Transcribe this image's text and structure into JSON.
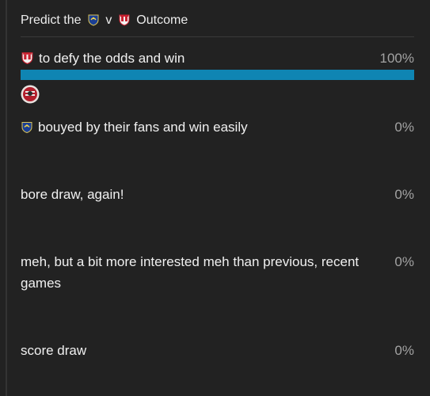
{
  "poll": {
    "title_prefix": "Predict the",
    "title_vs": "v",
    "title_suffix": "Outcome",
    "accent_color": "#0f85b3",
    "home_team_icon": "portsmouth-crest-icon",
    "away_team_icon": "southampton-crest-icon",
    "options": [
      {
        "label": "to defy the odds and win",
        "icon": "southampton-crest-icon",
        "percent_text": "100%",
        "percent": 100
      },
      {
        "label": "bouyed by their fans and win easily",
        "icon": "portsmouth-crest-icon",
        "percent_text": "0%",
        "percent": 0
      },
      {
        "label": "bore draw, again!",
        "percent_text": "0%",
        "percent": 0
      },
      {
        "label": "meh, but a bit more interested meh than previous, recent games",
        "percent_text": "0%",
        "percent": 0
      },
      {
        "label": "score draw",
        "percent_text": "0%",
        "percent": 0
      }
    ]
  }
}
